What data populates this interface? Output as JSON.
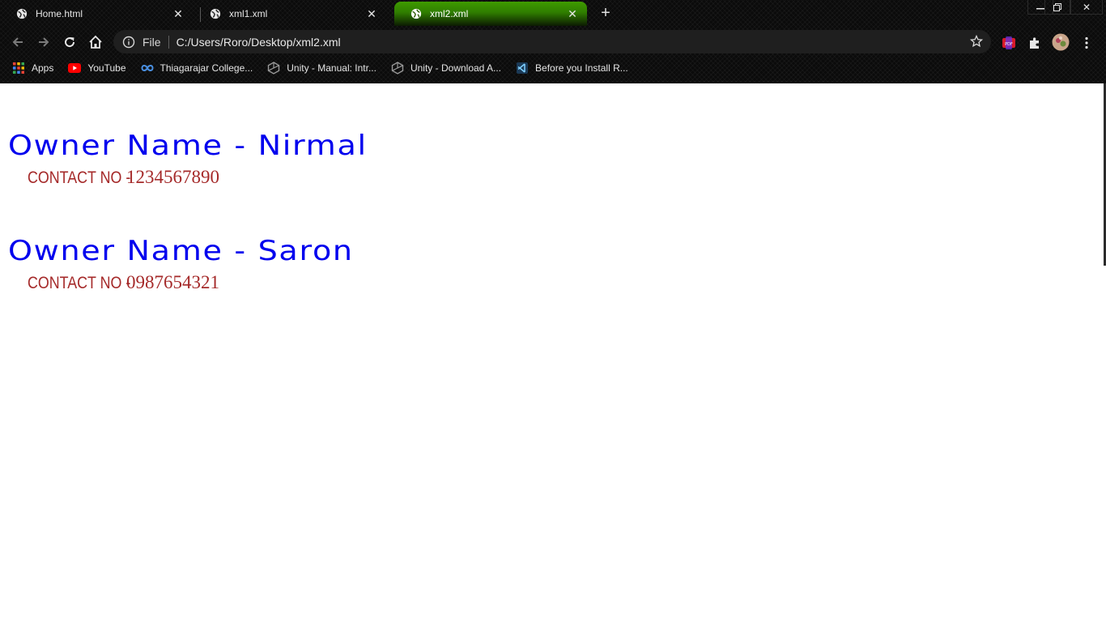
{
  "browser": {
    "tabs": [
      {
        "title": "Home.html",
        "active": false
      },
      {
        "title": "xml1.xml",
        "active": false
      },
      {
        "title": "xml2.xml",
        "active": true
      }
    ],
    "omnibox": {
      "scheme": "File",
      "url": "C:/Users/Roro/Desktop/xml2.xml"
    },
    "bookmarks": [
      {
        "label": "Apps",
        "icon": "apps-grid-icon"
      },
      {
        "label": "YouTube",
        "icon": "youtube-icon"
      },
      {
        "label": "Thiagarajar College...",
        "icon": "infinity-icon"
      },
      {
        "label": "Unity - Manual: Intr...",
        "icon": "unity-icon"
      },
      {
        "label": "Unity - Download A...",
        "icon": "unity-icon"
      },
      {
        "label": "Before you Install R...",
        "icon": "vscode-icon"
      }
    ],
    "accent_color": "#3f9b00"
  },
  "page": {
    "owners": [
      {
        "name": "Owner Name - Nirmal",
        "contact_label": "CONTACT NO -",
        "contact_number": "1234567890"
      },
      {
        "name": "Owner Name - Saron",
        "contact_label": "CONTACT NO -",
        "contact_number": "0987654321"
      }
    ],
    "owner_color": "#0000ee",
    "contact_color": "#a52a2a"
  }
}
